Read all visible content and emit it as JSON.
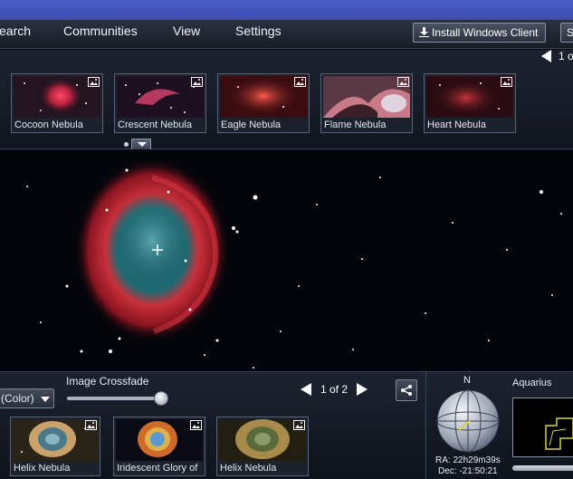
{
  "menu": {
    "items": [
      {
        "id": "search",
        "label": "earch"
      },
      {
        "id": "communities",
        "label": "Communities"
      },
      {
        "id": "view",
        "label": "View"
      },
      {
        "id": "settings",
        "label": "Settings"
      }
    ],
    "install_label": "Install Windows Client",
    "s_label": "S"
  },
  "top_strip": {
    "pager_text": "1 o",
    "thumbnails": [
      {
        "label": "Cocoon Nebula",
        "icon": "image-icon"
      },
      {
        "label": "Crescent Nebula",
        "icon": "image-icon"
      },
      {
        "label": "Eagle Nebula",
        "icon": "image-icon"
      },
      {
        "label": "Flame Nebula",
        "icon": "image-icon"
      },
      {
        "label": "Heart Nebula",
        "icon": "image-icon"
      }
    ]
  },
  "bottom": {
    "color_select_value": "(Color)",
    "crossfade_label": "Image Crossfade",
    "crossfade_value": 1.0,
    "pager": {
      "current": "1",
      "of": "of",
      "total": "2"
    },
    "thumbnails": [
      {
        "label": "Helix Nebula"
      },
      {
        "label": "Iridescent Glory of"
      },
      {
        "label": "Helix Nebula"
      }
    ],
    "compass_north": "N",
    "ra": "RA: 22h29m39s",
    "dec": "Dec: -21:50:21",
    "constellation": "Aquarius"
  },
  "colors": {
    "titlebar": "#4052bb",
    "panel": "#1a2030",
    "accent_line": "#d8d23a"
  }
}
